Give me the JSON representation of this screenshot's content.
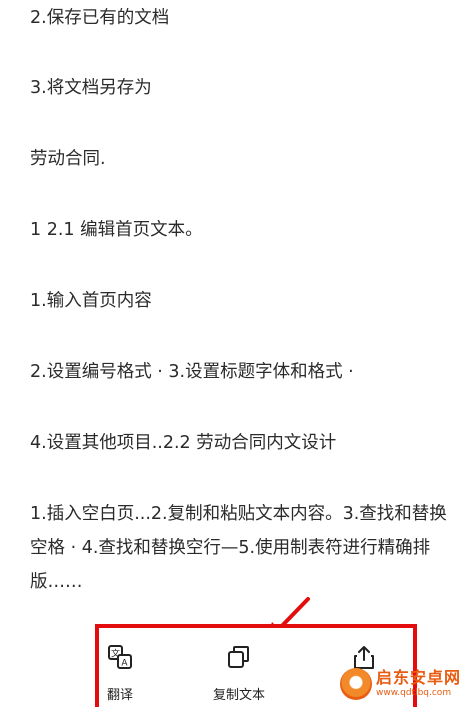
{
  "document": {
    "paragraphs": [
      "2.保存已有的文档",
      "3.将文档另存为",
      "劳动合同.",
      "1 2.1 编辑首页文本。",
      "1.输入首页内容",
      "2.设置编号格式 · 3.设置标题字体和格式 ·",
      "4.设置其他项目..2.2 劳动合同内文设计",
      "1.插入空白页...2.复制和粘贴文本内容。3.查找和替换空格 · 4.查找和替换空行—5.使用制表符进行精确排版……"
    ]
  },
  "toolbar": {
    "translate_label": "翻译",
    "copy_text_label": "复制文本",
    "translate_icon": "translate-icon",
    "copy_icon": "copy-icon",
    "share_icon": "share-icon"
  },
  "annotation": {
    "highlight_color": "#e30d0d"
  },
  "watermark": {
    "name": "启东安卓网",
    "url": "www.qdtlbq.com"
  }
}
